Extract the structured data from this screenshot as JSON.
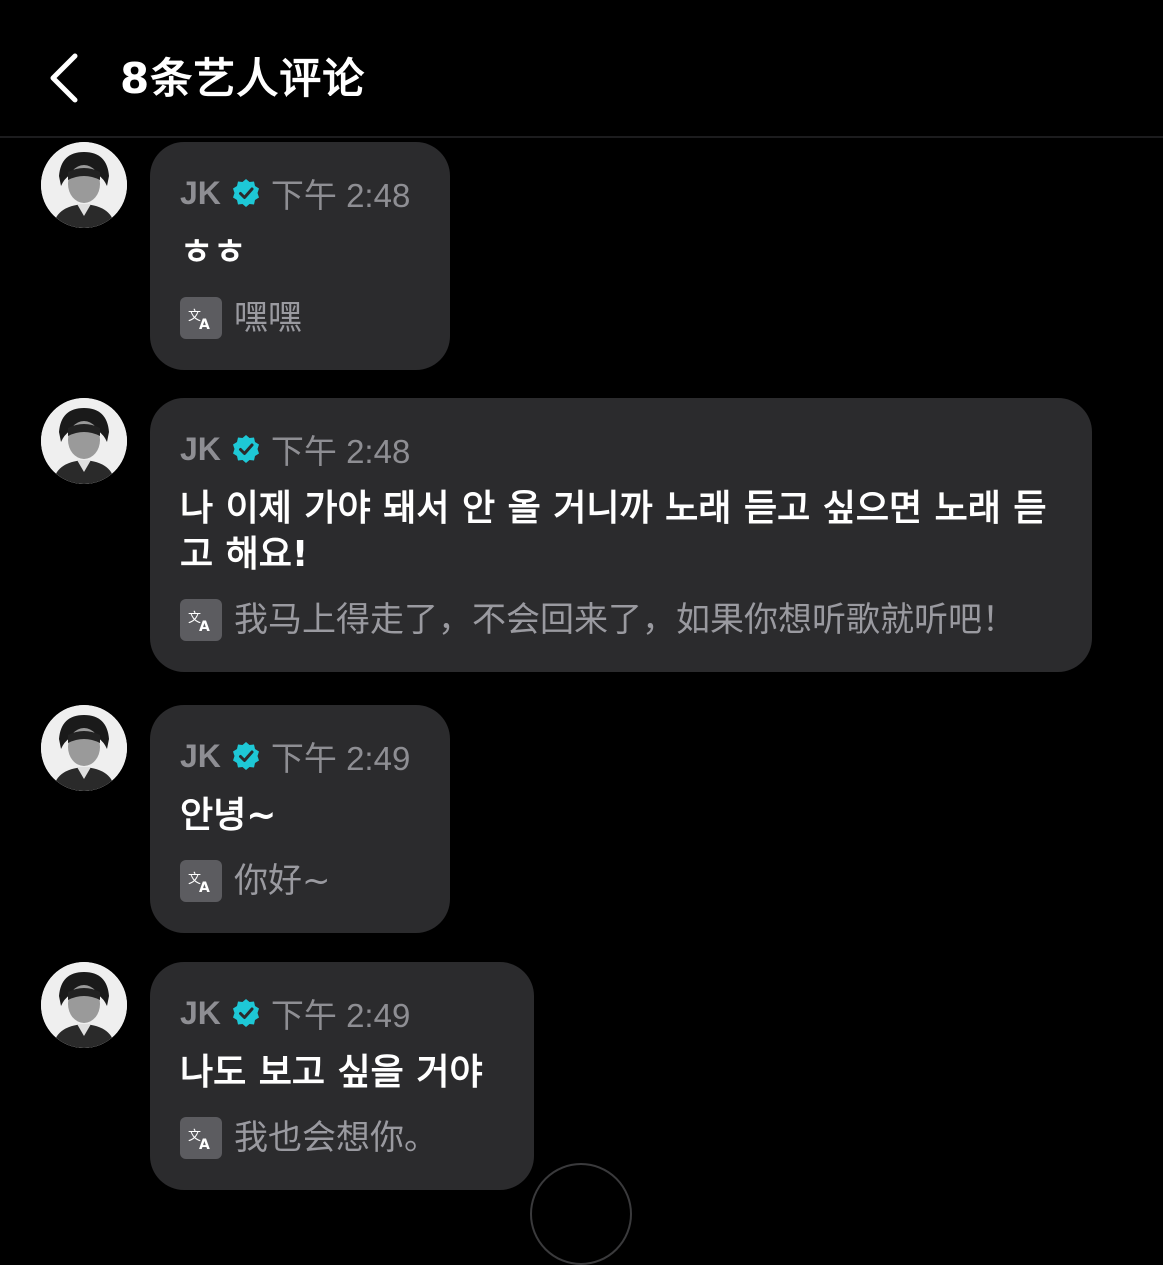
{
  "header": {
    "title": "8条艺人评论"
  },
  "comments": [
    {
      "author": "JK",
      "time": "下午 2:48",
      "message": "ㅎㅎ",
      "translation": "嘿嘿"
    },
    {
      "author": "JK",
      "time": "下午 2:48",
      "message": "나 이제 가야 돼서 안 올 거니까 노래 듣고 싶으면 노래 듣고 해요!",
      "translation": "我马上得走了，不会回来了，如果你想听歌就听吧！"
    },
    {
      "author": "JK",
      "time": "下午 2:49",
      "message": "안녕~",
      "translation": "你好~"
    },
    {
      "author": "JK",
      "time": "下午 2:49",
      "message": "나도 보고 싶을 거야",
      "translation": "我也会想你。"
    }
  ],
  "colors": {
    "background": "#000000",
    "bubble": "#2b2b2d",
    "verified_badge": "#1ec8d6",
    "muted_text": "#8e8e93"
  },
  "icons": {
    "back": "chevron-left-icon",
    "verified": "verified-badge-icon",
    "translate": "translate-icon"
  }
}
